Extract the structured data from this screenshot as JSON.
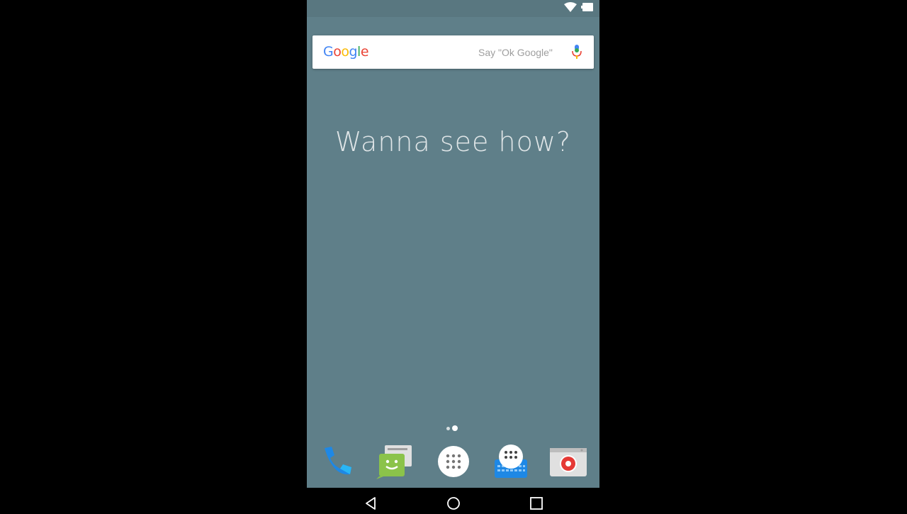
{
  "search": {
    "logo_letters": [
      "G",
      "o",
      "o",
      "g",
      "l",
      "e"
    ],
    "hint": "Say \"Ok Google\""
  },
  "headline": "Wanna see how?",
  "home_pages": {
    "count": 2,
    "current": 2
  },
  "dock": [
    {
      "name": "phone-app",
      "icon": "phone-icon"
    },
    {
      "name": "messaging-app",
      "icon": "messaging-icon"
    },
    {
      "name": "app-drawer",
      "icon": "app-drawer-icon"
    },
    {
      "name": "keyboard-app",
      "icon": "keyboard-icon"
    },
    {
      "name": "camera-app",
      "icon": "camera-icon"
    }
  ],
  "colors": {
    "wallpaper": "#5f7f89",
    "google_blue": "#4285f4",
    "google_red": "#ea4335",
    "google_yellow": "#fbbc05",
    "google_green": "#34a853"
  }
}
